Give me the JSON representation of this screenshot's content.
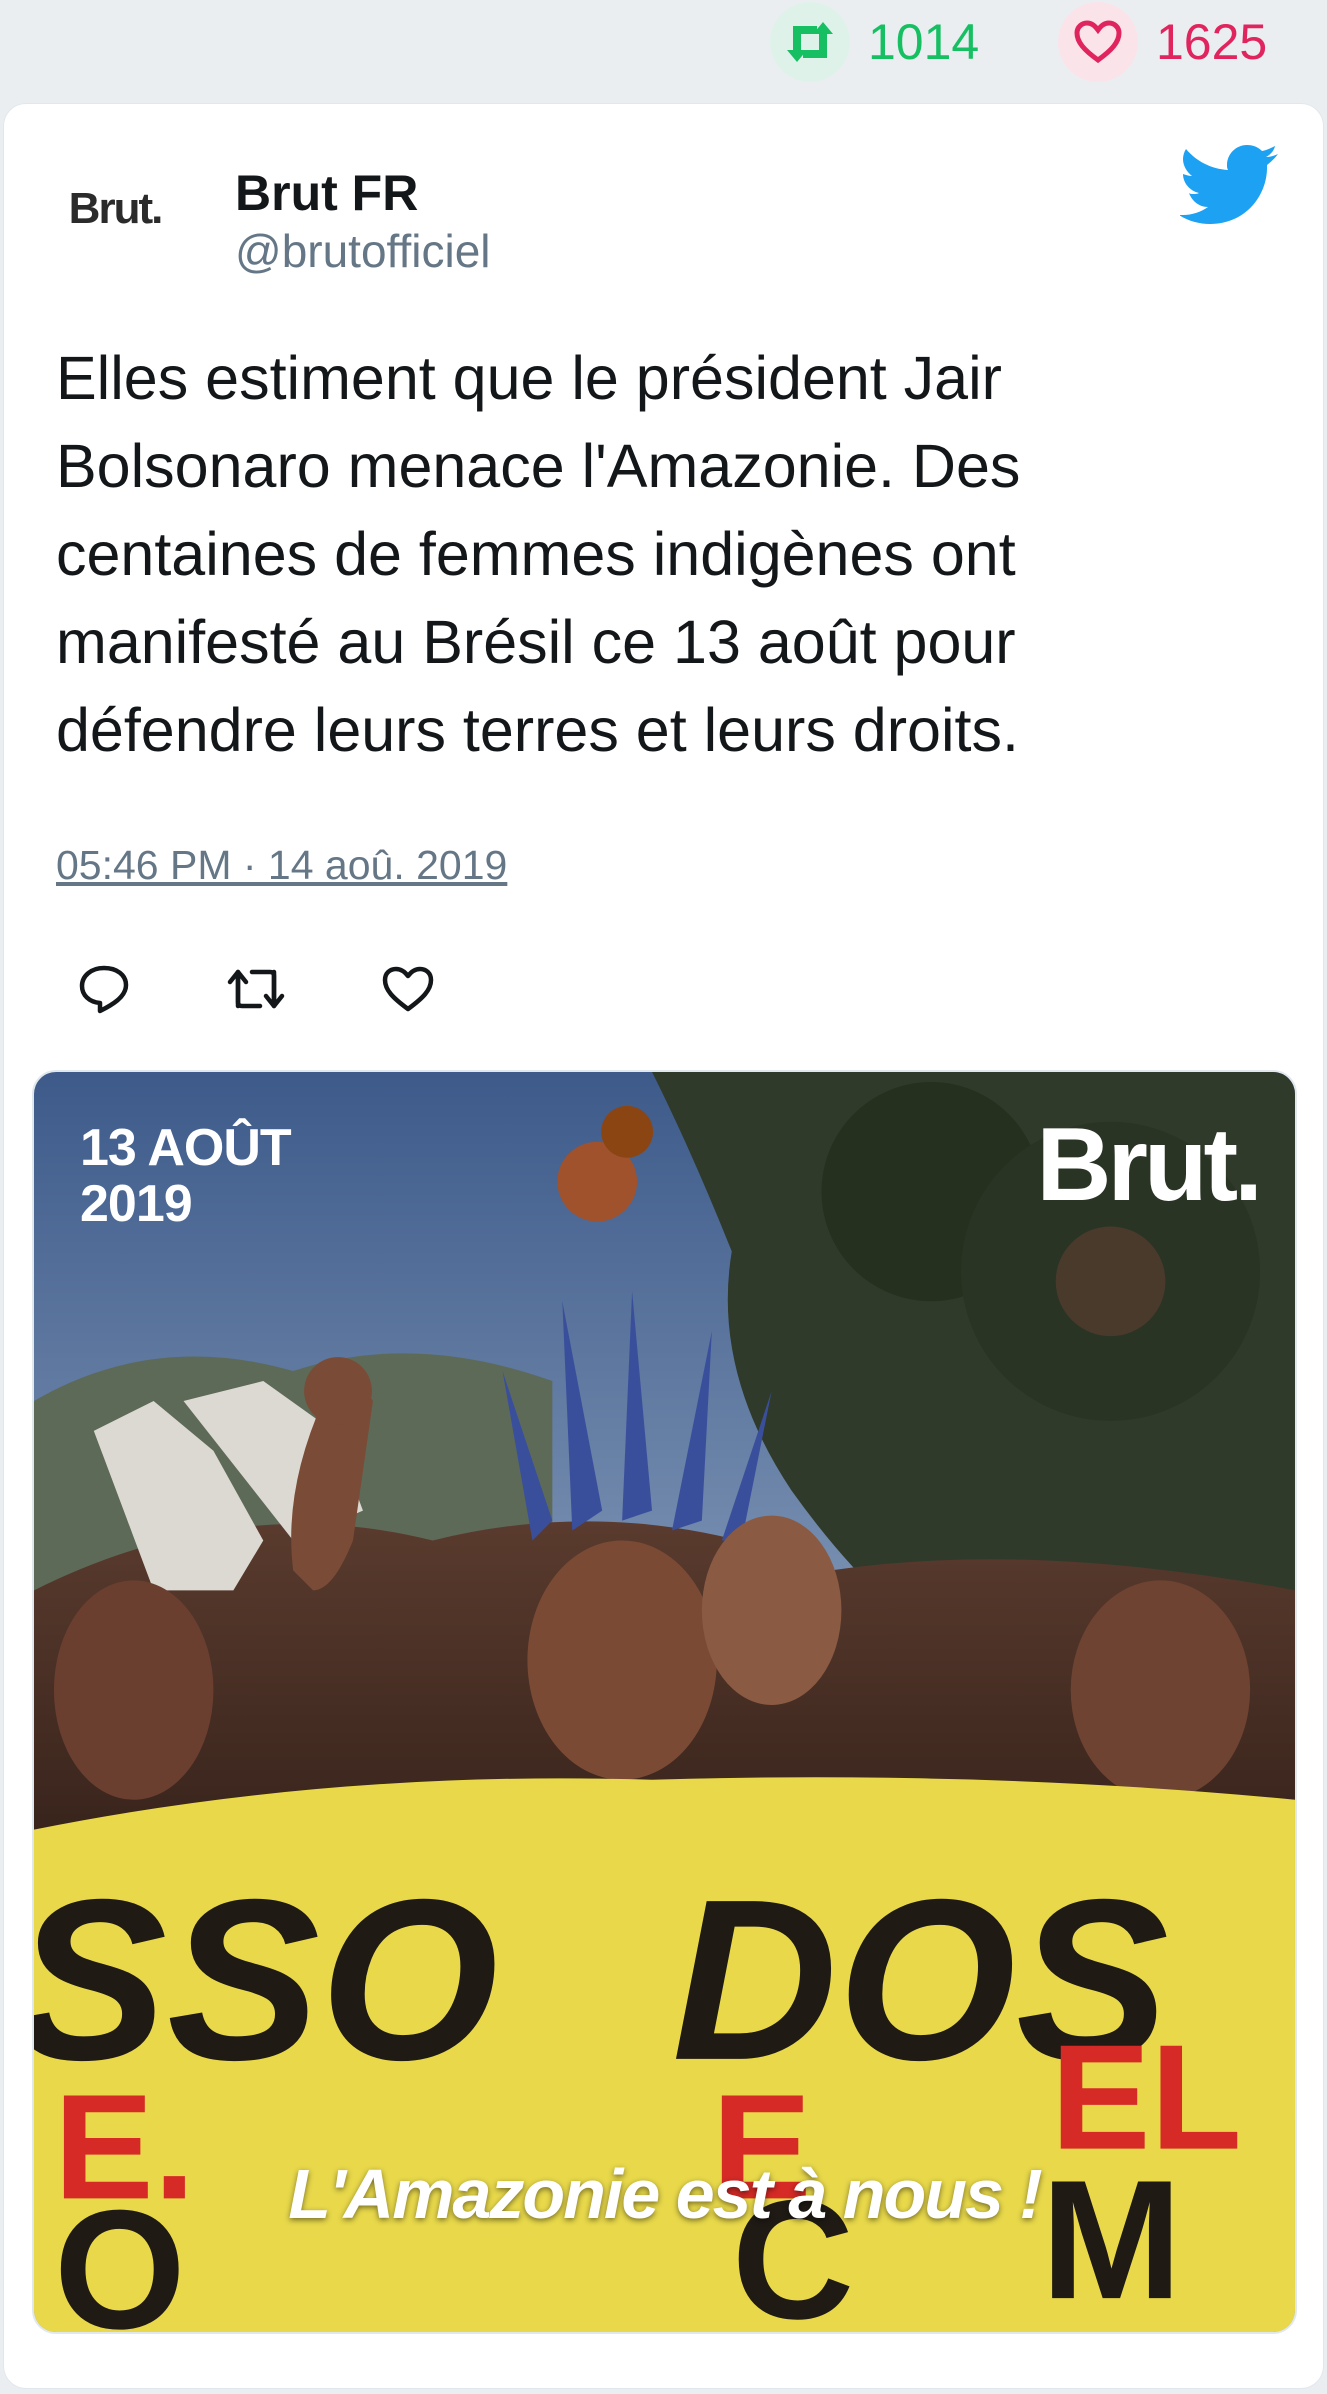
{
  "stats": {
    "retweets": "1014",
    "likes": "1625",
    "retweet_color": "#17bf63",
    "like_color": "#e0245e"
  },
  "author": {
    "avatar_text": "Brut.",
    "name": "Brut FR",
    "handle": "@brutofficiel"
  },
  "tweet": {
    "text": "Elles estiment que le président Jair Bolsonaro menace l'Amazonie. Des centaines de femmes indigènes ont manifesté au Brésil ce 13 août pour défendre leurs terres et leurs droits.",
    "timestamp": "05:46 PM · 14 aoû. 2019"
  },
  "actions": {
    "reply_icon": "reply-icon",
    "retweet_icon": "retweet-icon",
    "like_icon": "heart-icon"
  },
  "media": {
    "date_line1": "13 AOÛT",
    "date_line2": "2019",
    "brand": "Brut.",
    "caption": "L'Amazonie est à nous !",
    "banner_text": "SSO DOS",
    "banner_color": "#e8d84a"
  },
  "colors": {
    "twitter_blue": "#1da1f2",
    "text": "#14171a",
    "muted": "#657786"
  }
}
